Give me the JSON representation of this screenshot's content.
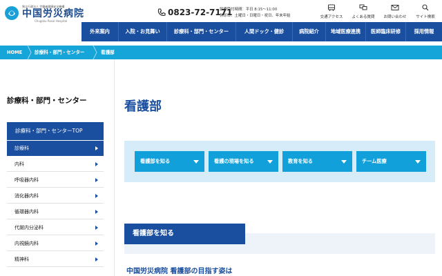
{
  "header": {
    "logo_small": "独立行政法人 労働者健康安全機構",
    "logo_name": "中国労災病院",
    "logo_en": "Chugoku Rosai Hospital",
    "phone": "0823-72-7171",
    "hours_line1": "診療受付時間：平日 8:15～11:00",
    "hours_line2": "休診日：土曜日・日曜日・祝日、年末年始",
    "utilities": [
      {
        "label": "交通アクセス",
        "icon": "bus-icon"
      },
      {
        "label": "よくある質問",
        "icon": "chat-icon"
      },
      {
        "label": "お問い合わせ",
        "icon": "mail-icon"
      },
      {
        "label": "サイト検索",
        "icon": "search-icon"
      }
    ]
  },
  "nav": {
    "items": [
      "外来案内",
      "入院・お見舞い",
      "診療科・部門・センター",
      "人間ドック・健診",
      "病院紹介",
      "地域医療連携",
      "医師臨床研修",
      "採用情報"
    ]
  },
  "breadcrumb": [
    "HOME",
    "診療科・部門・センター",
    "看護部"
  ],
  "sidebar": {
    "title": "診療科・部門・センター",
    "top_link": "診療科・部門・センターTOP",
    "items": [
      "診療科",
      "内科",
      "呼吸器内科",
      "消化器内科",
      "循環器内科",
      "代謝内分泌科",
      "内視鏡内科",
      "精神科"
    ]
  },
  "main": {
    "title": "看護部",
    "tabs": [
      "看護部を知る",
      "看護の現場を知る",
      "教育を知る",
      "チーム医療"
    ],
    "section_heading": "看護部を知る",
    "sub_heading": "中国労災病院 看護部の目指す姿は"
  },
  "colors": {
    "primary": "#1a4fa0",
    "accent": "#16a5d9",
    "tab_bg": "#d6ecf8"
  }
}
